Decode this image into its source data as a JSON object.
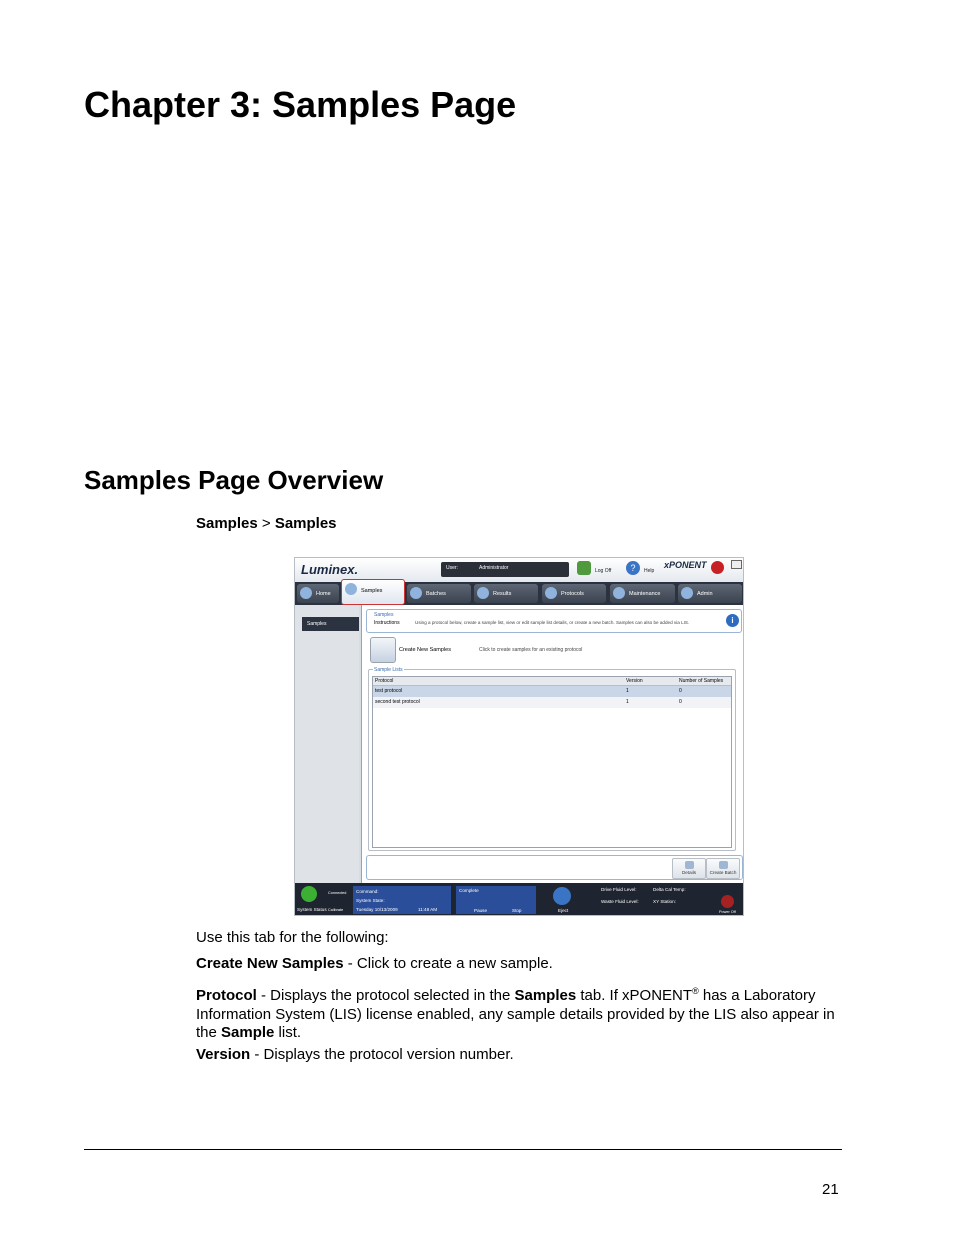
{
  "chapter_title": "Chapter 3: Samples Page",
  "section_title": "Samples Page Overview",
  "breadcrumb": {
    "first": "Samples",
    "separator": " > ",
    "second": "Samples"
  },
  "screenshot": {
    "logo": "Luminex.",
    "user_label": "User:",
    "user_value": "Administrator",
    "log_off": "Log Off",
    "help": "Help",
    "brand": "xPONENT",
    "tabs": [
      {
        "label": "Home"
      },
      {
        "label": "Samples"
      },
      {
        "label": "Batches"
      },
      {
        "label": "Results"
      },
      {
        "label": "Protocols"
      },
      {
        "label": "Maintenance"
      },
      {
        "label": "Admin"
      }
    ],
    "sidebar_item": "Samples",
    "instructions_heading": "Samples",
    "instructions_label": "Instructions",
    "instructions_text": "Using a protocol below, create a sample list, view or edit sample list details, or create a new batch. Samples can also be added via LIS.",
    "create_label": "Create New Samples",
    "create_desc": "Click to create samples for an existing protocol",
    "sample_lists_title": "Sample Lists",
    "columns": [
      "Protocol",
      "Version",
      "Number of Samples"
    ],
    "rows": [
      {
        "protocol": "test protocol",
        "version": "1",
        "count": "0"
      },
      {
        "protocol": "second test protocol",
        "version": "1",
        "count": "0"
      }
    ],
    "details_button": "Details",
    "create_batch_button": "Create Batch",
    "status": {
      "connected": "Connected",
      "system_status": "System Status",
      "calibrate": "Calibrate",
      "command_label": "Command:",
      "system_state_label": "System State:",
      "date": "Tuesday 10/13/2009",
      "time": "11:48 AM",
      "complete": "Complete",
      "pause": "Pause",
      "stop": "Stop",
      "eject": "Eject",
      "drive_fluid": "Drive Fluid Level:",
      "waste_fluid": "Waste Fluid Level:",
      "delta_cal_temp": "Delta Cal Temp:",
      "xy_station": "XY Station:",
      "power_off": "Power Off"
    }
  },
  "intro": "Use this tab for the following:",
  "items": {
    "create": {
      "term": "Create New Samples",
      "desc": " - Click to create a new sample."
    },
    "protocol": {
      "term": "Protocol",
      "desc1": " - Displays the protocol selected in the ",
      "bold1": "Samples",
      "desc2": " tab. If xPONENT",
      "sup": "®",
      "desc3": " has a Laboratory Information System (LIS) license enabled, any sample details provided by the LIS also appear in the ",
      "bold2": "Sample",
      "desc4": " list."
    },
    "version": {
      "term": "Version",
      "desc": " - Displays the protocol version number."
    }
  },
  "page_number": "21"
}
